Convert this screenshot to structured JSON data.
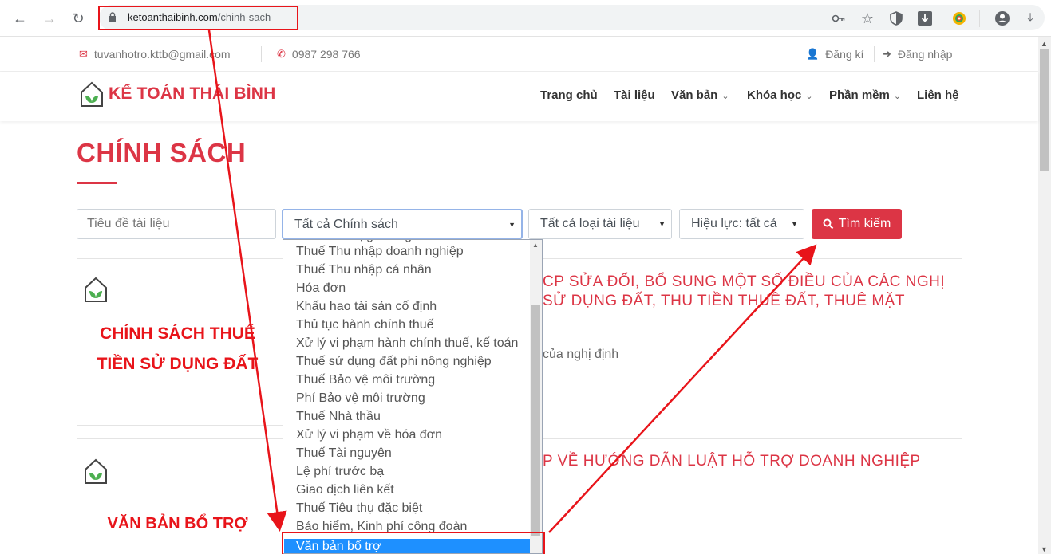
{
  "browser": {
    "url_domain": "ketoanthaibinh.com",
    "url_path": "/chinh-sach"
  },
  "topbar": {
    "email": "tuvanhotro.kttb@gmail.com",
    "phone": "0987 298 766",
    "register": "Đăng kí",
    "login": "Đăng nhập"
  },
  "header": {
    "logo_text": "KẾ TOÁN THÁI BÌNH",
    "nav": {
      "home": "Trang chủ",
      "docs": "Tài liệu",
      "texts": "Văn bản",
      "courses": "Khóa học",
      "software": "Phần mềm",
      "contact": "Liên hệ"
    }
  },
  "page": {
    "title": "CHÍNH SÁCH"
  },
  "filters": {
    "title_placeholder": "Tiêu đề tài liệu",
    "policy_selected": "Tất cả Chính sách",
    "doc_type_selected": "Tất cả loại tài liệu",
    "validity_selected": "Hiệu lực: tất cả",
    "search_button": "Tìm kiếm"
  },
  "dropdown_options": [
    "Thuế Thu nhập doanh nghiệp",
    "Thuế Thu nhập cá nhân",
    "Hóa đơn",
    "Khấu hao tài sản cố định",
    "Thủ tục hành chính thuế",
    "Xử lý vi phạm hành chính thuế, kế toán",
    "Thuế sử dụng đất phi nông nghiệp",
    "Thuế Bảo vệ môi trường",
    "Phí Bảo vệ môi trường",
    "Thuế Nhà thầu",
    "Xử lý vi phạm về hóa đơn",
    "Thuế Tài nguyên",
    "Lệ phí trước bạ",
    "Giao dịch liên kết",
    "Thuế Tiêu thụ đặc biệt",
    "Bảo hiểm, Kinh phí công đoàn"
  ],
  "dropdown_selected": "Văn bản bổ trợ",
  "results": [
    {
      "card_label_line1": "CHÍNH SÁCH THUẾ",
      "card_label_line2": "TIỀN SỬ DỤNG ĐẤT",
      "title_line1": "CP SỬA ĐỔI, BỔ SUNG MỘT SỐ ĐIỀU CỦA CÁC NGHỊ",
      "title_line2": "SỬ DỤNG ĐẤT, THU TIỀN THUÊ ĐẤT, THUÊ MẶT",
      "desc": "của nghị định"
    },
    {
      "card_label_line1": "VĂN BẢN BỔ TRỢ",
      "title_line1": "P VỀ HƯỚNG DẪN LUẬT HỖ TRỢ DOANH NGHIỆP"
    }
  ],
  "icons": {
    "back": "arrow-left-icon",
    "forward": "arrow-right-icon",
    "reload": "reload-icon",
    "lock": "lock-icon",
    "key": "key-icon",
    "star": "star-icon",
    "shield": "shield-icon",
    "download": "download-icon",
    "account": "account-icon",
    "menu": "menu-icon"
  },
  "colors": {
    "brand_red": "#dc3545",
    "annotation_red": "#e8141a",
    "selected_option": "#1e90ff"
  }
}
